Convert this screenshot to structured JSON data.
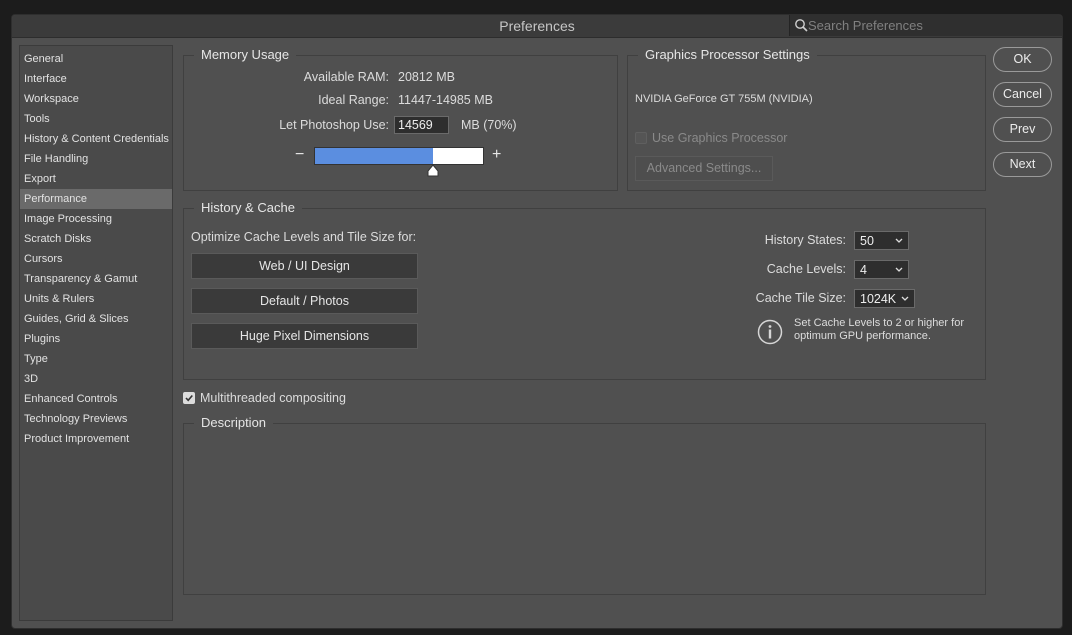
{
  "window": {
    "title": "Preferences"
  },
  "search": {
    "placeholder": "Search Preferences"
  },
  "sidebar": {
    "items": [
      {
        "label": "General"
      },
      {
        "label": "Interface"
      },
      {
        "label": "Workspace"
      },
      {
        "label": "Tools"
      },
      {
        "label": "History & Content Credentials"
      },
      {
        "label": "File Handling"
      },
      {
        "label": "Export"
      },
      {
        "label": "Performance"
      },
      {
        "label": "Image Processing"
      },
      {
        "label": "Scratch Disks"
      },
      {
        "label": "Cursors"
      },
      {
        "label": "Transparency & Gamut"
      },
      {
        "label": "Units & Rulers"
      },
      {
        "label": "Guides, Grid & Slices"
      },
      {
        "label": "Plugins"
      },
      {
        "label": "Type"
      },
      {
        "label": "3D"
      },
      {
        "label": "Enhanced Controls"
      },
      {
        "label": "Technology Previews"
      },
      {
        "label": "Product Improvement"
      }
    ],
    "selected": "Performance"
  },
  "memory": {
    "title": "Memory Usage",
    "available_label": "Available RAM:",
    "available_value": "20812 MB",
    "ideal_label": "Ideal Range:",
    "ideal_value": "11447-14985 MB",
    "use_label": "Let Photoshop Use:",
    "use_value": "14569",
    "use_suffix": "MB (70%)",
    "slider_fraction": 0.7,
    "minus": "−",
    "plus": "+"
  },
  "gpu": {
    "title": "Graphics Processor Settings",
    "device": "NVIDIA GeForce GT 755M (NVIDIA)",
    "use_label": "Use Graphics Processor",
    "use_checked": false,
    "advanced_label": "Advanced Settings..."
  },
  "cache": {
    "title": "History & Cache",
    "optimize_label": "Optimize Cache Levels and Tile Size for:",
    "buttons": {
      "web": "Web / UI Design",
      "default": "Default / Photos",
      "huge": "Huge Pixel Dimensions"
    },
    "history_label": "History States:",
    "history_value": "50",
    "levels_label": "Cache Levels:",
    "levels_value": "4",
    "tile_label": "Cache Tile Size:",
    "tile_value": "1024K",
    "info_line1": "Set Cache Levels to 2 or higher for",
    "info_line2": "optimum GPU performance."
  },
  "multithreaded": {
    "label": "Multithreaded compositing",
    "checked": true
  },
  "description": {
    "title": "Description"
  },
  "actions": {
    "ok": "OK",
    "cancel": "Cancel",
    "prev": "Prev",
    "next": "Next"
  },
  "colors": {
    "accent": "#5b8ee0",
    "dialog_bg": "#505050",
    "sidebar_bg": "#4a4a4a",
    "selected_bg": "#6a6a6a"
  },
  "icons": {
    "search": "search-icon",
    "info": "info-icon",
    "chevron": "chevron-down-icon",
    "check": "check-icon"
  }
}
